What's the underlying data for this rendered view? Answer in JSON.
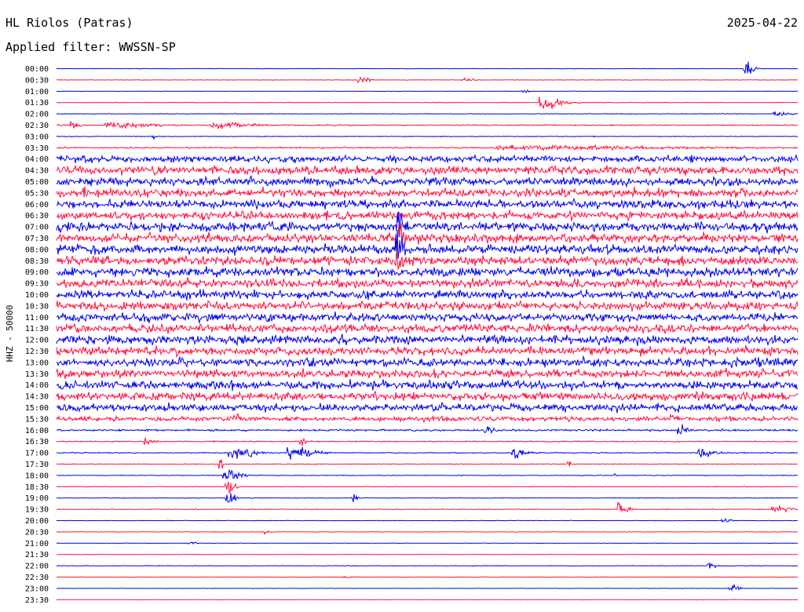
{
  "header": {
    "station": "HL Riolos (Patras)",
    "date": "2025-04-22",
    "filter": "Applied filter: WWSSN-SP"
  },
  "chart_data": {
    "type": "line",
    "ylabel": "HHZ - 50000",
    "colors": [
      "#0000ee",
      "#ff1040"
    ],
    "x_range_minutes": [
      0,
      30
    ],
    "rows": [
      {
        "label": "00:00",
        "amp": 0.5,
        "events": [
          {
            "t": 0.93,
            "a": 14,
            "w": 0.012
          }
        ]
      },
      {
        "label": "00:30",
        "amp": 0.5,
        "events": [
          {
            "t": 0.41,
            "a": 6,
            "w": 0.012
          },
          {
            "t": 0.55,
            "a": 5,
            "w": 0.012
          }
        ]
      },
      {
        "label": "01:00",
        "amp": 0.5,
        "events": [
          {
            "t": 0.63,
            "a": 4,
            "w": 0.01
          }
        ]
      },
      {
        "label": "01:30",
        "amp": 0.6,
        "events": [
          {
            "t": 0.66,
            "a": 10,
            "w": 0.03
          }
        ]
      },
      {
        "label": "02:00",
        "amp": 0.7,
        "events": [
          {
            "t": 0.97,
            "a": 6,
            "w": 0.015
          }
        ]
      },
      {
        "label": "02:30",
        "amp": 1.2,
        "events": [
          {
            "t": 0.02,
            "a": 8,
            "w": 0.01
          },
          {
            "t": 0.08,
            "a": 5,
            "w": 0.05
          },
          {
            "t": 0.22,
            "a": 6,
            "w": 0.04
          }
        ]
      },
      {
        "label": "03:00",
        "amp": 0.8,
        "events": [
          {
            "t": 0.13,
            "a": 4,
            "w": 0.005
          }
        ]
      },
      {
        "label": "03:30",
        "amp": 1.5,
        "events": [
          {
            "t": 0.65,
            "a": 3,
            "w": 0.2
          }
        ]
      },
      {
        "label": "04:00",
        "amp": 7,
        "events": []
      },
      {
        "label": "04:30",
        "amp": 9,
        "events": []
      },
      {
        "label": "05:00",
        "amp": 9,
        "events": []
      },
      {
        "label": "05:30",
        "amp": 9,
        "events": []
      },
      {
        "label": "06:00",
        "amp": 9,
        "events": []
      },
      {
        "label": "06:30",
        "amp": 9,
        "events": []
      },
      {
        "label": "07:00",
        "amp": 10,
        "events": [
          {
            "t": 0.46,
            "a": 60,
            "w": 0.006
          }
        ]
      },
      {
        "label": "07:30",
        "amp": 10,
        "events": [
          {
            "t": 0.46,
            "a": 40,
            "w": 0.008
          }
        ]
      },
      {
        "label": "08:00",
        "amp": 10,
        "events": [
          {
            "t": 0.46,
            "a": 30,
            "w": 0.008
          }
        ]
      },
      {
        "label": "08:30",
        "amp": 10,
        "events": [
          {
            "t": 0.46,
            "a": 30,
            "w": 0.01
          }
        ]
      },
      {
        "label": "09:00",
        "amp": 10,
        "events": []
      },
      {
        "label": "09:30",
        "amp": 10,
        "events": []
      },
      {
        "label": "10:00",
        "amp": 9,
        "events": []
      },
      {
        "label": "10:30",
        "amp": 9,
        "events": []
      },
      {
        "label": "11:00",
        "amp": 9,
        "events": []
      },
      {
        "label": "11:30",
        "amp": 9,
        "events": []
      },
      {
        "label": "12:00",
        "amp": 9,
        "events": []
      },
      {
        "label": "12:30",
        "amp": 9,
        "events": []
      },
      {
        "label": "13:00",
        "amp": 9,
        "events": []
      },
      {
        "label": "13:30",
        "amp": 9,
        "events": []
      },
      {
        "label": "14:00",
        "amp": 9,
        "events": []
      },
      {
        "label": "14:30",
        "amp": 9,
        "events": []
      },
      {
        "label": "15:00",
        "amp": 8,
        "events": []
      },
      {
        "label": "15:30",
        "amp": 5,
        "events": [
          {
            "t": 0.24,
            "a": 20,
            "w": 0.005
          },
          {
            "t": 0.83,
            "a": 20,
            "w": 0.006
          }
        ]
      },
      {
        "label": "16:00",
        "amp": 2,
        "events": [
          {
            "t": 0.58,
            "a": 10,
            "w": 0.01
          },
          {
            "t": 0.84,
            "a": 12,
            "w": 0.01
          }
        ]
      },
      {
        "label": "16:30",
        "amp": 1.2,
        "events": [
          {
            "t": 0.12,
            "a": 8,
            "w": 0.01
          },
          {
            "t": 0.33,
            "a": 5,
            "w": 0.01
          }
        ]
      },
      {
        "label": "17:00",
        "amp": 1.0,
        "events": [
          {
            "t": 0.24,
            "a": 10,
            "w": 0.03
          },
          {
            "t": 0.32,
            "a": 12,
            "w": 0.03
          },
          {
            "t": 0.62,
            "a": 8,
            "w": 0.02
          },
          {
            "t": 0.87,
            "a": 9,
            "w": 0.02
          }
        ]
      },
      {
        "label": "17:30",
        "amp": 0.8,
        "events": [
          {
            "t": 0.22,
            "a": 25,
            "w": 0.003
          },
          {
            "t": 0.69,
            "a": 10,
            "w": 0.003
          }
        ]
      },
      {
        "label": "18:00",
        "amp": 0.8,
        "events": [
          {
            "t": 0.23,
            "a": 12,
            "w": 0.02
          },
          {
            "t": 0.75,
            "a": 6,
            "w": 0.004
          }
        ]
      },
      {
        "label": "18:30",
        "amp": 0.7,
        "events": [
          {
            "t": 0.23,
            "a": 18,
            "w": 0.01
          }
        ]
      },
      {
        "label": "19:00",
        "amp": 0.7,
        "events": [
          {
            "t": 0.23,
            "a": 15,
            "w": 0.01
          },
          {
            "t": 0.4,
            "a": 8,
            "w": 0.006
          }
        ]
      },
      {
        "label": "19:30",
        "amp": 0.8,
        "events": [
          {
            "t": 0.76,
            "a": 12,
            "w": 0.012
          },
          {
            "t": 0.97,
            "a": 5,
            "w": 0.02
          }
        ]
      },
      {
        "label": "20:00",
        "amp": 0.6,
        "events": [
          {
            "t": 0.9,
            "a": 3,
            "w": 0.01
          }
        ]
      },
      {
        "label": "20:30",
        "amp": 0.6,
        "events": [
          {
            "t": 0.28,
            "a": 5,
            "w": 0.005
          }
        ]
      },
      {
        "label": "21:00",
        "amp": 0.5,
        "events": [
          {
            "t": 0.18,
            "a": 2,
            "w": 0.01
          }
        ]
      },
      {
        "label": "21:30",
        "amp": 0.5,
        "events": []
      },
      {
        "label": "22:00",
        "amp": 0.6,
        "events": [
          {
            "t": 0.88,
            "a": 5,
            "w": 0.01
          }
        ]
      },
      {
        "label": "22:30",
        "amp": 0.5,
        "events": [
          {
            "t": 0.39,
            "a": 2,
            "w": 0.01
          }
        ]
      },
      {
        "label": "23:00",
        "amp": 0.5,
        "events": [
          {
            "t": 0.91,
            "a": 6,
            "w": 0.012
          }
        ]
      },
      {
        "label": "23:30",
        "amp": 0.5,
        "events": []
      }
    ]
  }
}
